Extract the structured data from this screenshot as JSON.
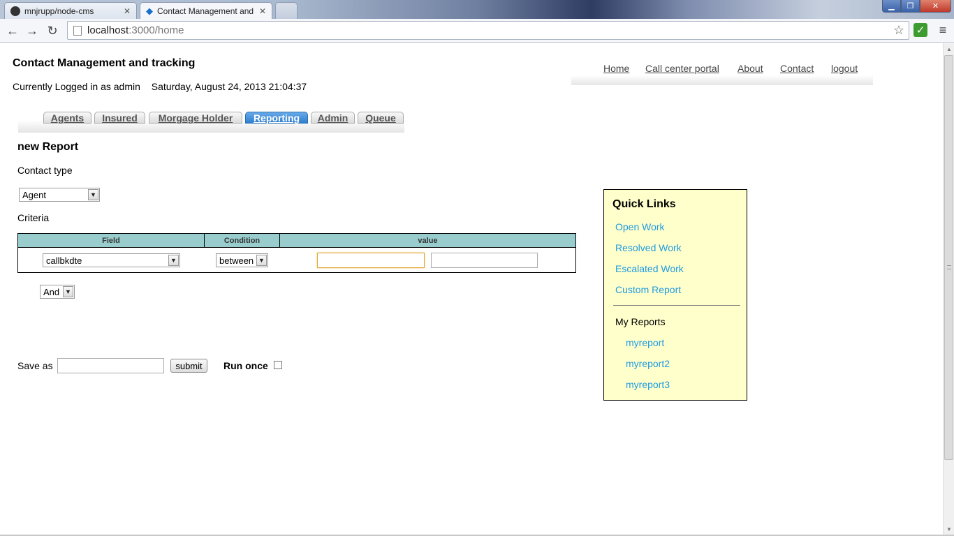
{
  "browser": {
    "tabs": [
      {
        "title": "mnjrupp/node-cms",
        "icon": "github-icon",
        "active": false
      },
      {
        "title": "Contact Management and",
        "icon": "app-diamond-icon",
        "active": true
      }
    ],
    "url_host": "localhost",
    "url_path": ":3000/home"
  },
  "header": {
    "title": "Contact Management and tracking",
    "logged_in": "Currently Logged in as admin",
    "datetime": "Saturday, August 24, 2013 21:04:37"
  },
  "topnav": [
    "Home",
    "Call center portal",
    "About",
    "Contact",
    "logout"
  ],
  "tabs": [
    {
      "label": "Agents",
      "active": false
    },
    {
      "label": "Insured",
      "active": false
    },
    {
      "label": "Morgage Holder",
      "active": false
    },
    {
      "label": "Reporting",
      "active": true
    },
    {
      "label": "Admin",
      "active": false
    },
    {
      "label": "Queue",
      "active": false
    }
  ],
  "report": {
    "heading": "new Report",
    "contact_type_label": "Contact type",
    "contact_type_value": "Agent",
    "criteria_label": "Criteria",
    "columns": [
      "Field",
      "Condition",
      "value"
    ],
    "row": {
      "field": "callbkdte",
      "condition": "between",
      "value1": "",
      "value2": ""
    },
    "conjunction": "And",
    "save_as_label": "Save as",
    "save_as_value": "",
    "submit_label": "submit",
    "run_once_label": "Run once",
    "run_once_checked": false
  },
  "quick_links": {
    "title": "Quick Links",
    "links": [
      "Open Work",
      "Resolved Work",
      "Escalated Work",
      "Custom Report"
    ],
    "my_reports_label": "My Reports",
    "my_reports": [
      "myreport",
      "myreport2",
      "myreport3"
    ]
  },
  "colors": {
    "table_header": "#99cccc",
    "quick_links_bg": "#ffffcc",
    "link": "#1e9be0",
    "active_tab": "#2f7fd0"
  }
}
